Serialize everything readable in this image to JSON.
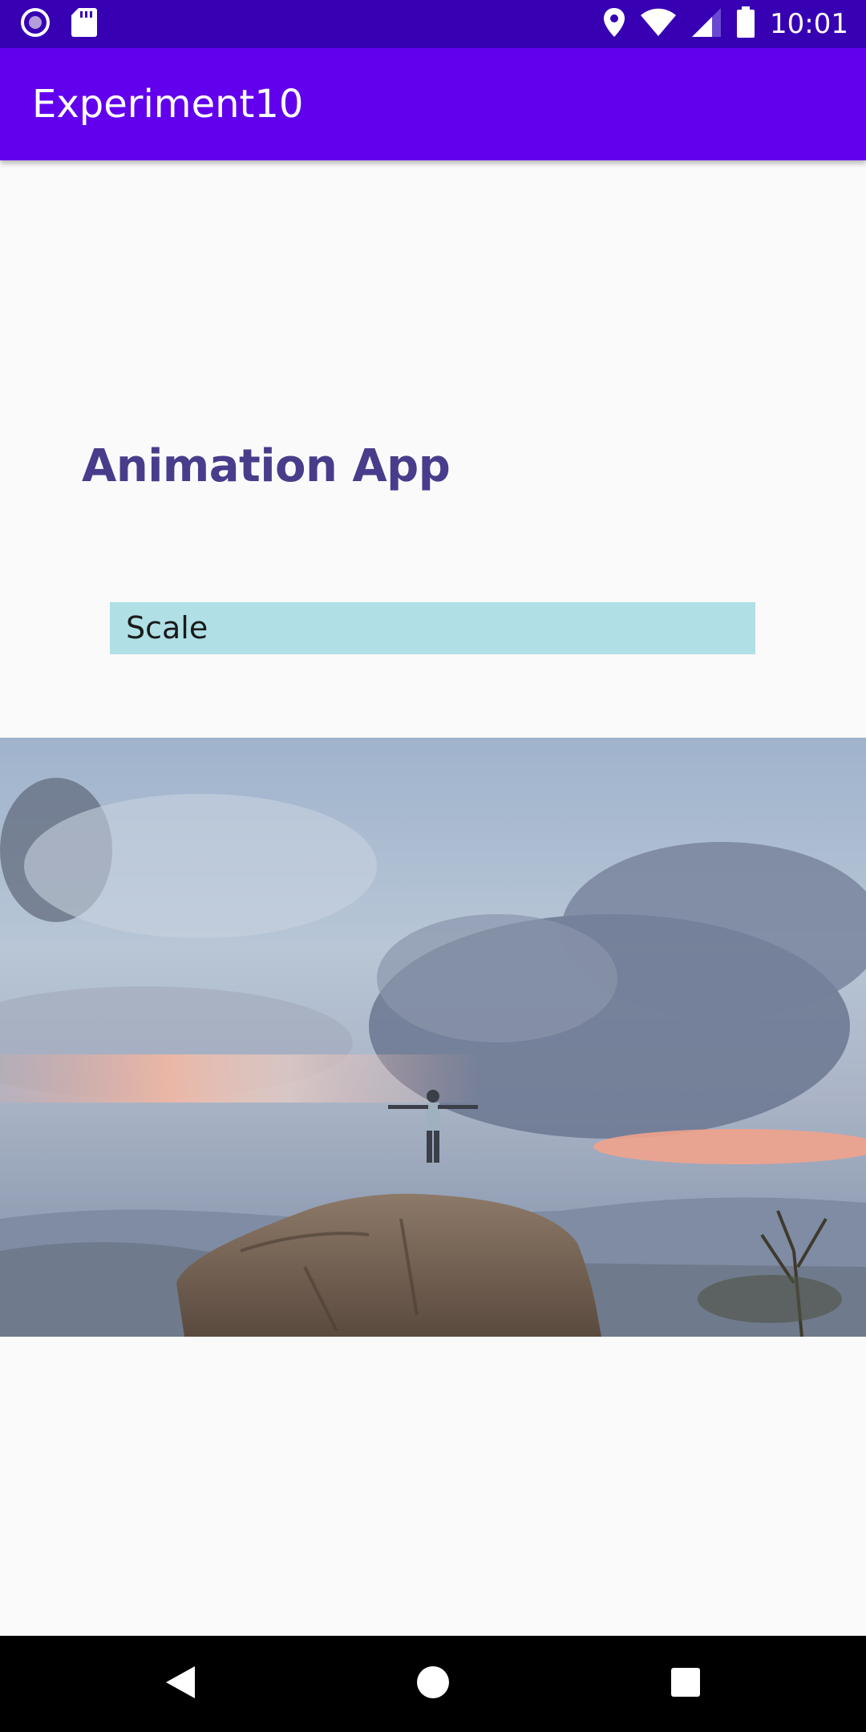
{
  "status_bar": {
    "time": "10:01",
    "left_icons": [
      "record-icon",
      "sd-card-icon"
    ],
    "right_icons": [
      "location-icon",
      "wifi-icon",
      "signal-icon",
      "battery-icon"
    ],
    "background": "#3700b3"
  },
  "app_bar": {
    "title": "Experiment10",
    "background": "#6200ee"
  },
  "main": {
    "heading": "Animation App",
    "heading_color": "#483d8b",
    "scale_button_label": "Scale",
    "scale_button_color": "#b0e0e6",
    "image_description_icon": "landscape-photo"
  },
  "nav_bar": {
    "buttons": [
      "back-icon",
      "home-icon",
      "recents-icon"
    ]
  }
}
